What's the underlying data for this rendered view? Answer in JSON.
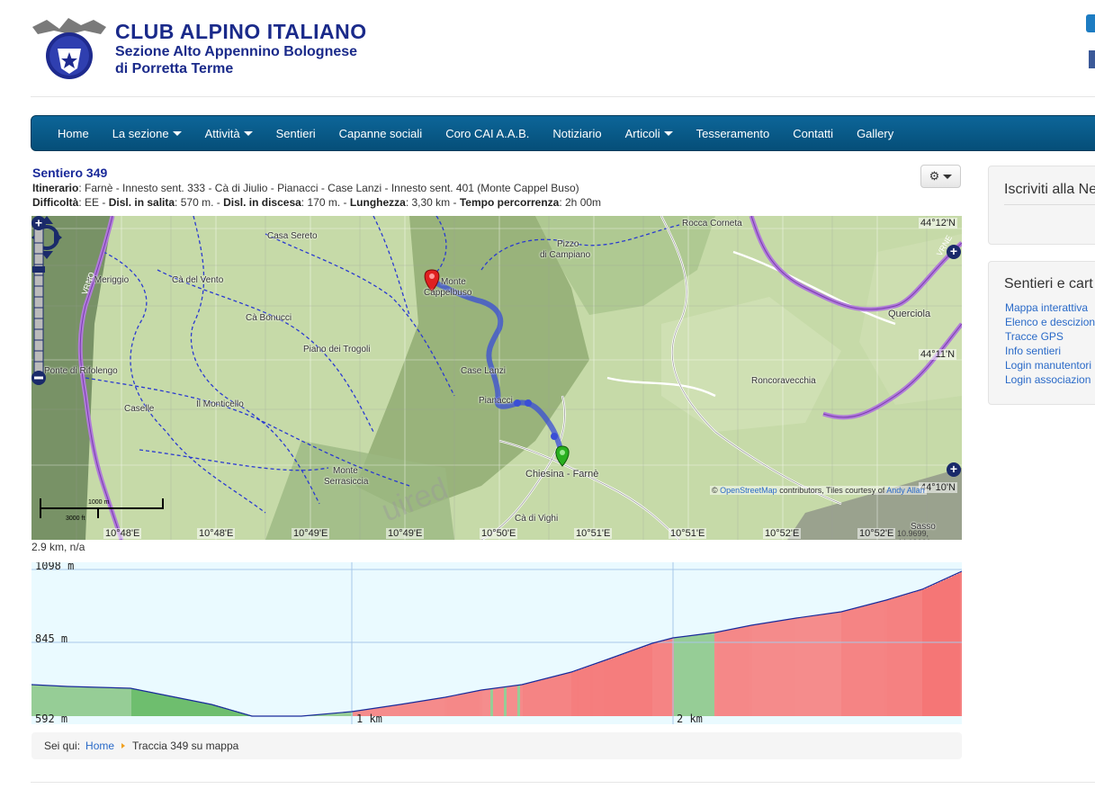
{
  "header": {
    "title": "CLUB ALPINO ITALIANO",
    "subtitle1": "Sezione Alto Appennino Bolognese",
    "subtitle2": "di Porretta Terme"
  },
  "nav": {
    "items": [
      {
        "label": "Home",
        "dropdown": false
      },
      {
        "label": "La sezione",
        "dropdown": true
      },
      {
        "label": "Attività",
        "dropdown": true
      },
      {
        "label": "Sentieri",
        "dropdown": false
      },
      {
        "label": "Capanne sociali",
        "dropdown": false
      },
      {
        "label": "Coro CAI A.A.B.",
        "dropdown": false
      },
      {
        "label": "Notiziario",
        "dropdown": false
      },
      {
        "label": "Articoli",
        "dropdown": true
      },
      {
        "label": "Tesseramento",
        "dropdown": false
      },
      {
        "label": "Contatti",
        "dropdown": false
      },
      {
        "label": "Gallery",
        "dropdown": false
      }
    ]
  },
  "trail": {
    "title": "Sentiero 349",
    "itinerary_label": "Itinerario",
    "itinerary": ": Farnè - Innesto sent. 333 - Cà di Jiulio - Pianacci - Case Lanzi - Innesto sent. 401 (Monte Cappel Buso)",
    "difficulty_label": "Difficoltà",
    "difficulty": ": EE - ",
    "ascent_label": "Disl. in salita",
    "ascent": ": 570 m. - ",
    "descent_label": "Disl. in discesa",
    "descent": ": 170 m. - ",
    "length_label": "Lunghezza",
    "length": ": 3,30 km - ",
    "time_label": "Tempo percorrenza",
    "time": ": 2h 00m"
  },
  "tools": {
    "gear_icon": "gear-icon"
  },
  "map": {
    "place_labels": [
      "Rocca Corneta",
      "Casa Sereto",
      "Pizzo",
      "di Campiano",
      "Il Meriggio",
      "Cà del Vento",
      "Monte",
      "Cappelbuso",
      "Cà Bonucci",
      "Querciola",
      "Piano dei Trogoli",
      "Ponte di Rifolengo",
      "Case Lanzi",
      "Roncoravecchia",
      "Pianacci",
      "Caselle",
      "Il Monticello",
      "Chiesina - Farnè",
      "Monte",
      "Serrasiccia",
      "Cà di Vighi",
      "Sasso",
      "VRNO",
      "VRNE"
    ],
    "lat_labels": [
      "44°12'N",
      "44°11'N",
      "44°10'N"
    ],
    "lon_labels": [
      "10°48'E",
      "10°48'E",
      "10°49'E",
      "10°49'E",
      "10°50'E",
      "10°51'E",
      "10°51'E",
      "10°52'E",
      "10°52'E"
    ],
    "attribution_prefix": "© ",
    "attribution_osm": "OpenStreetMap",
    "attribution_mid": " contributors, Tiles courtesy of ",
    "attribution_andy": "Andy Allan",
    "scale_top": "1000 m",
    "scale_bottom": "3000 ft",
    "mouse_position": "10.9699, 44.19661",
    "track_color": "#3a4ed6"
  },
  "profile": {
    "distance_info": "2.9 km, n/a",
    "y_labels": [
      "1098 m",
      "845 m",
      "592 m"
    ],
    "x_labels": [
      "1 km",
      "2 km"
    ]
  },
  "breadcrumb": {
    "prefix": "Sei qui:",
    "home": "Home",
    "current": "Traccia 349 su mappa"
  },
  "sidebar": {
    "newsletter_title": "Iscriviti alla Ne",
    "trails_title": "Sentieri e cart",
    "links": [
      "Mappa interattiva",
      "Elenco e descizion",
      "Tracce GPS",
      "Info sentieri",
      "Login manutentori",
      "Login associazion"
    ]
  }
}
